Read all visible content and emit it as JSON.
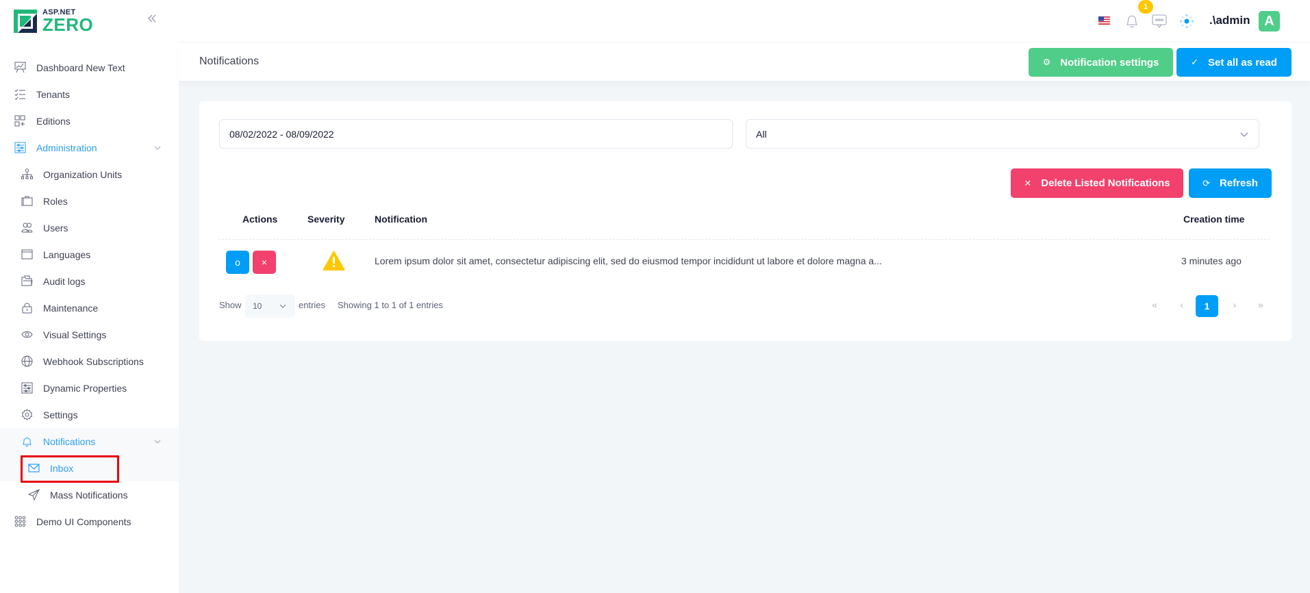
{
  "brand": {
    "logo_small": "ASP.NET",
    "logo_big": "ZERO",
    "collapse_icon": "double-chevron-left-icon"
  },
  "sidebar": {
    "items": [
      {
        "label": "Dashboard New Text",
        "icon": "chart-board-icon"
      },
      {
        "label": "Tenants",
        "icon": "checklist-icon"
      },
      {
        "label": "Editions",
        "icon": "grid-plus-icon"
      },
      {
        "label": "Administration",
        "icon": "sliders-icon",
        "expanded": true
      },
      {
        "label": "Organization Units",
        "icon": "sitemap-icon"
      },
      {
        "label": "Roles",
        "icon": "briefcase-icon"
      },
      {
        "label": "Users",
        "icon": "users-icon"
      },
      {
        "label": "Languages",
        "icon": "window-icon"
      },
      {
        "label": "Audit logs",
        "icon": "folder-icon"
      },
      {
        "label": "Maintenance",
        "icon": "lock-icon"
      },
      {
        "label": "Visual Settings",
        "icon": "eye-icon"
      },
      {
        "label": "Webhook Subscriptions",
        "icon": "globe-icon"
      },
      {
        "label": "Dynamic Properties",
        "icon": "sliders-icon"
      },
      {
        "label": "Settings",
        "icon": "gear-icon"
      },
      {
        "label": "Notifications",
        "icon": "bell-icon",
        "expanded": true
      },
      {
        "label": "Inbox",
        "icon": "envelope-icon",
        "active": true
      },
      {
        "label": "Mass Notifications",
        "icon": "paper-plane-icon"
      },
      {
        "label": "Demo UI Components",
        "icon": "dots-grid-icon"
      }
    ]
  },
  "topbar": {
    "language_icon": "us-flag-icon",
    "notification_count": "1",
    "username": ".\\admin",
    "avatar_letter": "A",
    "colors": {
      "avatar": "#50cd89",
      "badge": "#ffc700"
    }
  },
  "subheader": {
    "title": "Notifications",
    "notification_settings_label": "Notification settings",
    "set_all_read_label": "Set all as read"
  },
  "filters": {
    "date_range": "08/02/2022 - 08/09/2022",
    "state_select": "All"
  },
  "actions": {
    "delete_label": "Delete Listed Notifications",
    "refresh_label": "Refresh"
  },
  "table": {
    "columns": [
      "Actions",
      "Severity",
      "Notification",
      "Creation time"
    ],
    "rows": [
      {
        "mark_read_glyph": "o",
        "delete_glyph": "×",
        "severity": "warning",
        "notification": "Lorem ipsum dolor sit amet, consectetur adipiscing elit, sed do eiusmod tempor incididunt ut labore et dolore magna a...",
        "creation_time": "3 minutes ago"
      }
    ]
  },
  "footer": {
    "show_label": "Show",
    "page_size": "10",
    "entries_label": "entries",
    "info": "Showing 1 to 1 of 1 entries",
    "pager": {
      "first": "«",
      "prev": "‹",
      "current": "1",
      "next": "›",
      "last": "»"
    }
  },
  "colors": {
    "primary": "#009ef7",
    "success": "#50cd89",
    "danger": "#f1416c",
    "warning": "#ffc700"
  }
}
